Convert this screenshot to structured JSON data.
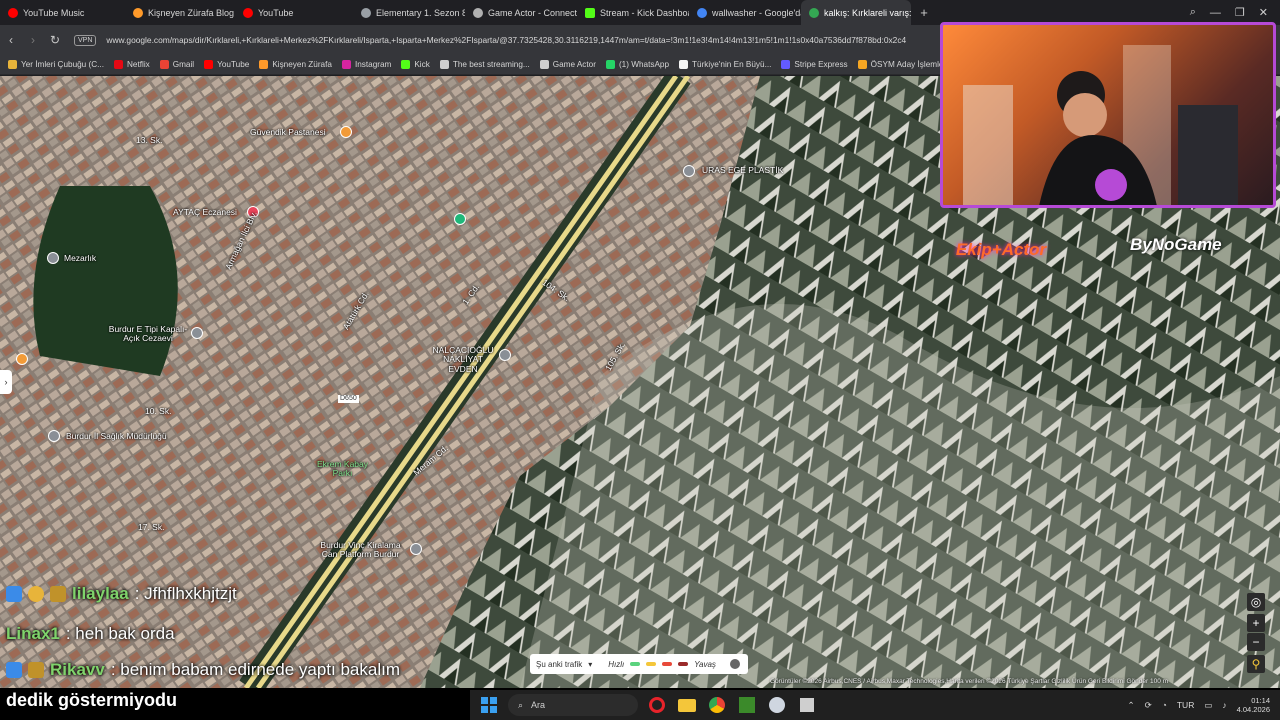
{
  "browser": {
    "tabs": [
      {
        "label": "YouTube Music",
        "color": "#ff0000"
      },
      {
        "label": "Kişneyen Zürafa Blog",
        "color": "#ff9a2a"
      },
      {
        "label": "YouTube",
        "color": "#ff0000"
      },
      {
        "label": "Elementary 1. Sezon 8. Bö",
        "color": "#9aa0a6"
      },
      {
        "label": "Game Actor - Connect wi",
        "color": "#b0b0b0"
      },
      {
        "label": "Stream - Kick Dashboard",
        "color": "#53fc18"
      },
      {
        "label": "wallwasher - Google'da A",
        "color": "#4285f4"
      },
      {
        "label": "kalkış: Kırklareli varış: Ispa",
        "color": "#34a853"
      }
    ],
    "new_tab": "+",
    "vpn": "VPN",
    "url": "www.google.com/maps/dir/Kırklareli,+Kırklareli+Merkez%2FKırklareli/Isparta,+Isparta+Merkez%2FIsparta/@37.7325428,30.3116219,1447m/am=t/data=!3m1!1e3!4m14!4m13!1m5!1m1!1s0x40a7536dd7f878bd:0x2c4",
    "bookmarks": [
      {
        "label": "Yer İmleri Çubuğu (C...",
        "color": "#e8b43a"
      },
      {
        "label": "Netflix",
        "color": "#e50914"
      },
      {
        "label": "Gmail",
        "color": "#ea4335"
      },
      {
        "label": "YouTube",
        "color": "#ff0000"
      },
      {
        "label": "Kişneyen Zürafa",
        "color": "#ff9a2a"
      },
      {
        "label": "Instagram",
        "color": "#d6249f"
      },
      {
        "label": "Kick",
        "color": "#53fc18"
      },
      {
        "label": "The best streaming...",
        "color": "#cfcfcf"
      },
      {
        "label": "Game Actor",
        "color": "#cfcfcf"
      },
      {
        "label": "(1) WhatsApp",
        "color": "#25d366"
      },
      {
        "label": "Türkiye'nin En Büyü...",
        "color": "#f5f5f5"
      },
      {
        "label": "Stripe Express",
        "color": "#635bff"
      },
      {
        "label": "ÖSYM Aday İşlemle...",
        "color": "#f5a623"
      }
    ]
  },
  "map": {
    "labels": [
      {
        "text": "Güvendik Pastanesi",
        "type": "white"
      },
      {
        "text": "URAS EGE PLASTİK",
        "type": "white"
      },
      {
        "text": "AYTAÇ Eczanesi",
        "type": "white"
      },
      {
        "text": "Mezarlık",
        "type": "white"
      },
      {
        "text": "Burdur E Tipi Kapalı-Açık Cezaevi",
        "type": "white"
      },
      {
        "text": "NALÇACIOĞLU NAKLİYAT EVDEN",
        "type": "white"
      },
      {
        "text": "Burdur İl Sağlık Müdürlüğü",
        "type": "white"
      },
      {
        "text": "Ekrem Kabay Parkı",
        "type": "green"
      },
      {
        "text": "Burdur Vinç Kiralama Can Platform Burdur",
        "type": "white"
      },
      {
        "text": "D650",
        "type": "white"
      },
      {
        "text": "1. Cd.",
        "type": "white"
      },
      {
        "text": "Meram Cd.",
        "type": "white"
      },
      {
        "text": "Armağan İlci Blv.",
        "type": "white"
      },
      {
        "text": "Atatürk Cd.",
        "type": "white"
      },
      {
        "text": "13. Sk.",
        "type": "white"
      },
      {
        "text": "10. Sk.",
        "type": "white"
      },
      {
        "text": "17. Sk.",
        "type": "white"
      },
      {
        "text": "104. Sk.",
        "type": "white"
      },
      {
        "text": "105. Sk.",
        "type": "white"
      }
    ],
    "traffic": {
      "label": "Şu anki trafik",
      "fast": "Hızlı",
      "slow": "Yavaş"
    },
    "copyright": "Görüntüler ©2026 Airbus,CNES / Airbus,Maxar Technologies,Harita verileri ©2026   Türkiye   Şartlar   Gizlilik   Ürün Geri Bildirimi Gönder   100 m",
    "controls": {
      "locate": "◎",
      "zoom_in": "+",
      "zoom_out": "−",
      "pegman": "⚲"
    }
  },
  "overlay": {
    "brand1": "Ekip+Actor",
    "brand2": "ByNoGame",
    "chat": [
      {
        "user": "lilaylaa",
        "msg": ": Jfhflhxkhjtzjt"
      },
      {
        "user": "Linax1",
        "msg": ": heh bak orda"
      },
      {
        "user": "Rikavv",
        "msg": ": benim babam edirnede yaptı bakalım"
      }
    ],
    "subtitle": "dedik göstermiyodu"
  },
  "taskbar": {
    "search": "Ara",
    "lang": "TUR",
    "time": "01:14",
    "date": "4.04.2026"
  }
}
